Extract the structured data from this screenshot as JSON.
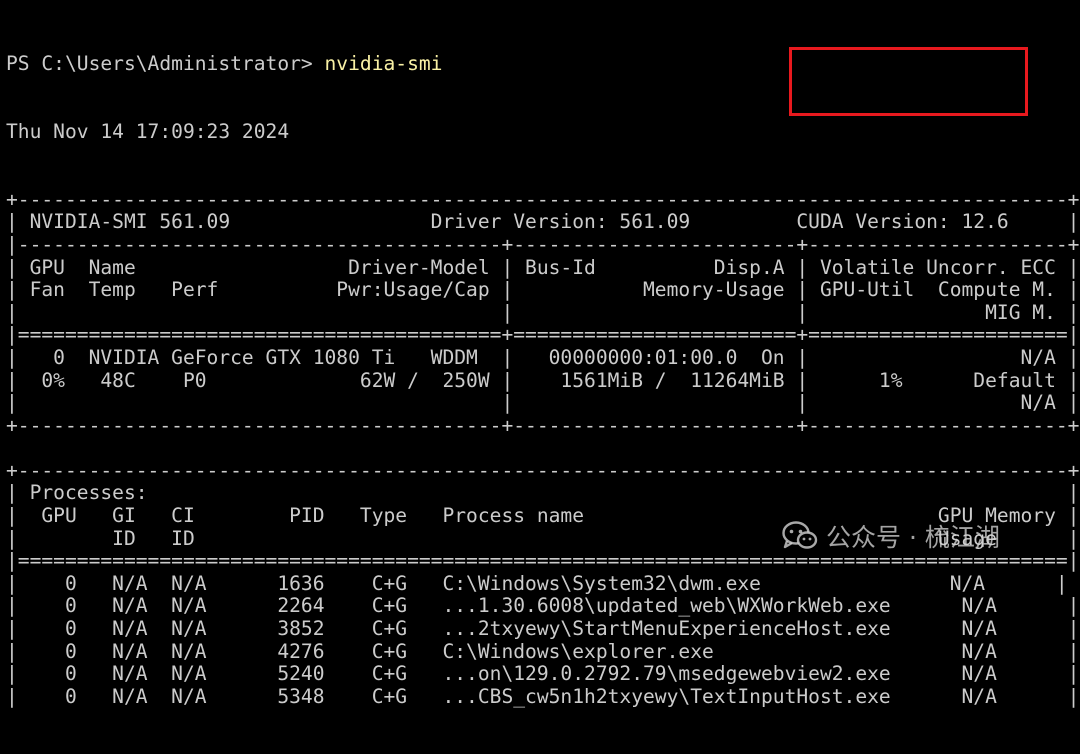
{
  "terminal": {
    "prompt": "PS C:\\Users\\Administrator> ",
    "command": "nvidia-smi",
    "timestamp": "Thu Nov 14 17:09:23 2024",
    "lines": [
      "+-----------------------------------------------------------------------------------------+",
      "| NVIDIA-SMI 561.09                 Driver Version: 561.09         CUDA Version: 12.6     |",
      "|-----------------------------------------+------------------------+----------------------+",
      "| GPU  Name                  Driver-Model | Bus-Id          Disp.A | Volatile Uncorr. ECC |",
      "| Fan  Temp   Perf          Pwr:Usage/Cap |           Memory-Usage | GPU-Util  Compute M. |",
      "|                                         |                        |               MIG M. |",
      "|=========================================+========================+======================|",
      "|   0  NVIDIA GeForce GTX 1080 Ti   WDDM  |   00000000:01:00.0  On |                  N/A |",
      "|  0%   48C    P0             62W /  250W |    1561MiB /  11264MiB |      1%      Default |",
      "|                                         |                        |                  N/A |",
      "+-----------------------------------------+------------------------+----------------------+",
      "",
      "+-----------------------------------------------------------------------------------------+",
      "| Processes:                                                                              |",
      "|  GPU   GI   CI        PID   Type   Process name                              GPU Memory |",
      "|        ID   ID                                                               Usage      |",
      "|=========================================================================================|",
      "|    0   N/A  N/A      1636    C+G   C:\\Windows\\System32\\dwm.exe                N/A      |",
      "|    0   N/A  N/A      2264    C+G   ...1.30.6008\\updated_web\\WXWorkWeb.exe      N/A      |",
      "|    0   N/A  N/A      3852    C+G   ...2txyewy\\StartMenuExperienceHost.exe      N/A      |",
      "|    0   N/A  N/A      4276    C+G   C:\\Windows\\explorer.exe                     N/A      |",
      "|    0   N/A  N/A      5240    C+G   ...on\\129.0.2792.79\\msedgewebview2.exe      N/A      |",
      "|    0   N/A  N/A      5348    C+G   ...CBS_cw5n1h2txyewy\\TextInputHost.exe      N/A      |"
    ]
  },
  "highlight": {
    "color": "#e8191e",
    "target_text": "CUDA Version: 12.6"
  },
  "watermark": {
    "icon": "wechat-icon",
    "text": "公众号 · 梳江湖"
  },
  "colors": {
    "background": "#000000",
    "foreground": "#cccccc",
    "command": "#f9f1a5"
  }
}
